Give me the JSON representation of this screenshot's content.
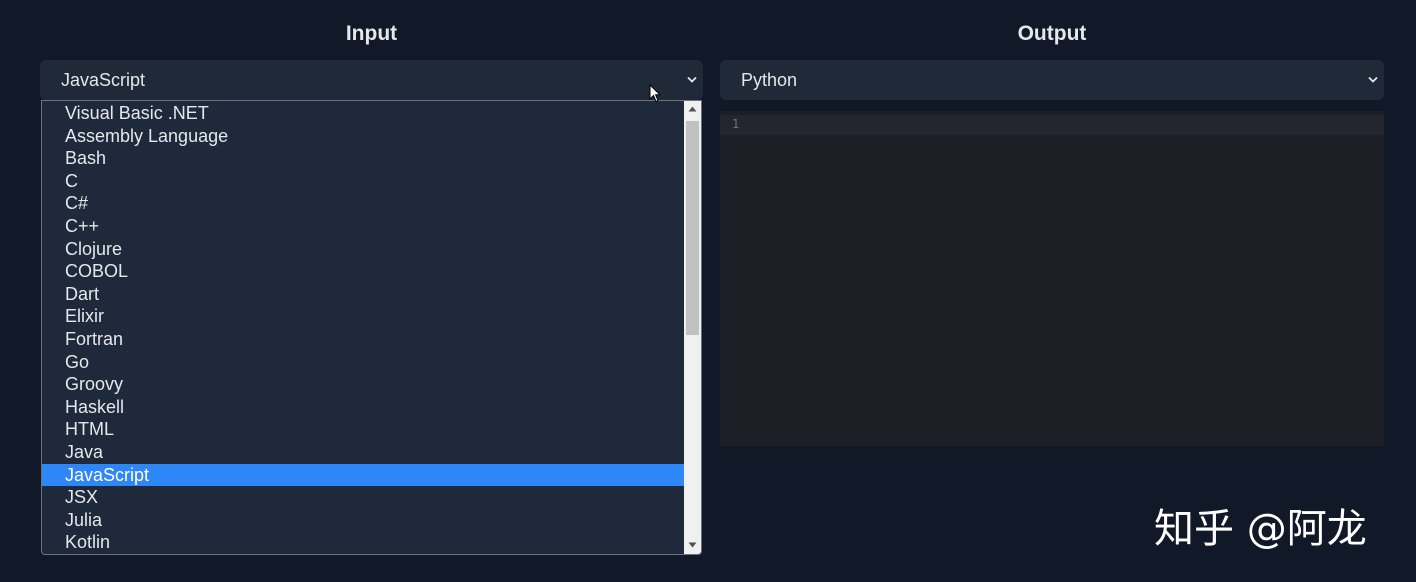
{
  "input": {
    "title": "Input",
    "selected": "JavaScript",
    "options": [
      "Visual Basic .NET",
      "Assembly Language",
      "Bash",
      "C",
      "C#",
      "C++",
      "Clojure",
      "COBOL",
      "Dart",
      "Elixir",
      "Fortran",
      "Go",
      "Groovy",
      "Haskell",
      "HTML",
      "Java",
      "JavaScript",
      "JSX",
      "Julia",
      "Kotlin"
    ],
    "highlighted_option": "JavaScript"
  },
  "output": {
    "title": "Output",
    "selected": "Python",
    "editor": {
      "line_numbers": [
        "1"
      ]
    }
  },
  "watermark": "知乎 @阿龙",
  "colors": {
    "background": "#111827",
    "select_bg": "#1f2937",
    "list_bg": "#1e293b",
    "highlight": "#2f86f6",
    "editor_bg": "#1e1e27"
  },
  "icons": {
    "select_arrow": "chevron-down-icon",
    "cursor": "mouse-pointer-icon"
  }
}
